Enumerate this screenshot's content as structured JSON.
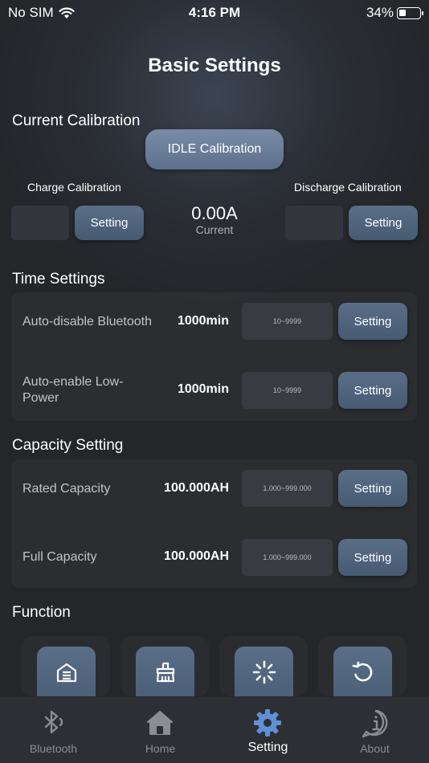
{
  "status_bar": {
    "carrier": "No SIM",
    "time": "4:16 PM",
    "battery": "34%",
    "battery_level": 0.34
  },
  "page_title": "Basic Settings",
  "current_calibration": {
    "title": "Current Calibration",
    "idle_button": "IDLE Calibration",
    "charge_label": "Charge Calibration",
    "discharge_label": "Discharge Calibration",
    "charge_button": "Setting",
    "discharge_button": "Setting",
    "current_value": "0.00A",
    "current_label": "Current"
  },
  "time_settings": {
    "title": "Time Settings",
    "rows": [
      {
        "label": "Auto-disable Bluetooth",
        "value": "1000min",
        "placeholder": "10~9999",
        "button": "Setting"
      },
      {
        "label": "Auto-enable Low-Power",
        "value": "1000min",
        "placeholder": "10~9999",
        "button": "Setting"
      }
    ]
  },
  "capacity_setting": {
    "title": "Capacity Setting",
    "rows": [
      {
        "label": "Rated Capacity",
        "value": "100.000AH",
        "placeholder": "1.000~999.000",
        "button": "Setting"
      },
      {
        "label": "Full Capacity",
        "value": "100.000AH",
        "placeholder": "1.000~999.000",
        "button": "Setting"
      }
    ]
  },
  "function": {
    "title": "Function",
    "items": [
      "home-building-icon",
      "broom-icon",
      "loading-spinner-icon",
      "refresh-icon"
    ]
  },
  "tabbar": {
    "tabs": [
      {
        "label": "Bluetooth",
        "icon": "bluetooth-icon",
        "active": false
      },
      {
        "label": "Home",
        "icon": "home-icon",
        "active": false
      },
      {
        "label": "Setting",
        "icon": "gear-icon",
        "active": true
      },
      {
        "label": "About",
        "icon": "info-icon",
        "active": false
      }
    ]
  },
  "colors": {
    "accent": "#5f8fd6",
    "button": "#52667f",
    "background": "#2a2e35",
    "inactive_tab": "#8a8e94"
  }
}
